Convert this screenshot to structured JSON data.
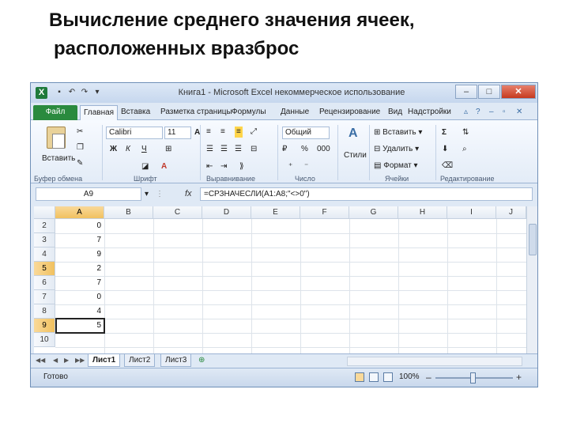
{
  "slide": {
    "title_line1": "Вычисление среднего значения ячеек,",
    "title_line2": "расположенных вразброс"
  },
  "window": {
    "title": "Книга1 - Microsoft Excel некоммерческое использование",
    "logo": "X",
    "minimize": "–",
    "maximize": "□",
    "close": "✕"
  },
  "ribbon_tabs": [
    "Файл",
    "Главная",
    "Вставка",
    "Разметка страницы",
    "Формулы",
    "Данные",
    "Рецензирование",
    "Вид",
    "Надстройки"
  ],
  "ribbon": {
    "paste_label": "Вставить",
    "font_name": "Calibri",
    "font_size": "11",
    "bold": "Ж",
    "italic": "К",
    "underline": "Ч",
    "number_format": "Общий",
    "percent": "%",
    "thousands": "000",
    "styles_label": "Стили",
    "insert": "Вставить",
    "delete": "Удалить",
    "format": "Формат",
    "sigma": "Σ",
    "groups": {
      "clipboard": "Буфер обмена",
      "font": "Шрифт",
      "alignment": "Выравнивание",
      "number": "Число",
      "cells": "Ячейки",
      "editing": "Редактирование"
    }
  },
  "formula_bar": {
    "name_box": "A9",
    "fx": "fx",
    "formula": "=СРЗНАЧЕСЛИ(A1:A8;\"<>0\")"
  },
  "grid": {
    "columns": [
      "A",
      "B",
      "C",
      "D",
      "E",
      "F",
      "G",
      "H",
      "I",
      "J"
    ],
    "rows": [
      {
        "num": "2",
        "a": "0"
      },
      {
        "num": "3",
        "a": "7"
      },
      {
        "num": "4",
        "a": "9"
      },
      {
        "num": "5",
        "a": "2"
      },
      {
        "num": "6",
        "a": "7"
      },
      {
        "num": "7",
        "a": "0"
      },
      {
        "num": "8",
        "a": "4"
      },
      {
        "num": "9",
        "a": "5"
      },
      {
        "num": "10",
        "a": ""
      }
    ]
  },
  "sheets": [
    "Лист1",
    "Лист2",
    "Лист3"
  ],
  "status": {
    "ready": "Готово",
    "zoom": "100%",
    "zoom_minus": "–",
    "zoom_plus": "+"
  },
  "colors": {
    "file_tab": "#2a8a3e",
    "selection": "#f1c15f",
    "chrome": "#dfe9f5"
  }
}
